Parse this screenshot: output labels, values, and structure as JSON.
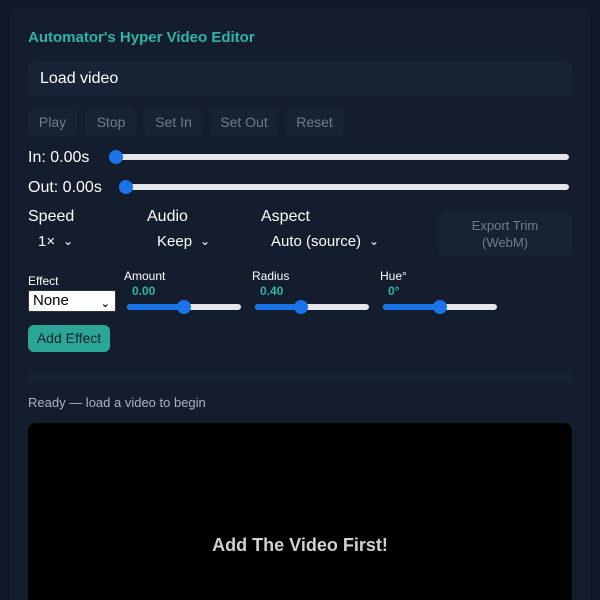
{
  "app": {
    "title": "Automator's Hyper Video Editor"
  },
  "load": {
    "label": "Load video"
  },
  "controls": {
    "play": "Play",
    "stop": "Stop",
    "set_in": "Set In",
    "set_out": "Set Out",
    "reset": "Reset"
  },
  "trim": {
    "in_label": "In: 0.00s",
    "out_label": "Out: 0.00s",
    "in_position": 0,
    "out_position": 0
  },
  "speed": {
    "label": "Speed",
    "value": "1×"
  },
  "audio": {
    "label": "Audio",
    "value": "Keep"
  },
  "aspect": {
    "label": "Aspect",
    "value": "Auto (source)"
  },
  "export": {
    "label_line1": "Export Trim",
    "label_line2": "(WebM)"
  },
  "effect": {
    "label": "Effect",
    "value": "None"
  },
  "amount": {
    "label": "Amount",
    "value": "0.00",
    "level": 0.5
  },
  "radius": {
    "label": "Radius",
    "value": "0.40",
    "level": 0.4
  },
  "hue": {
    "label": "Hue°",
    "value": "0°",
    "level": 0.5
  },
  "add_effect": {
    "label": "Add Effect"
  },
  "status": {
    "text": "Ready — load a video to begin"
  },
  "preview": {
    "message": "Add The Video First!"
  },
  "colors": {
    "accent": "#2fb5a5",
    "slider": "#1a73e8",
    "background": "#101828"
  }
}
